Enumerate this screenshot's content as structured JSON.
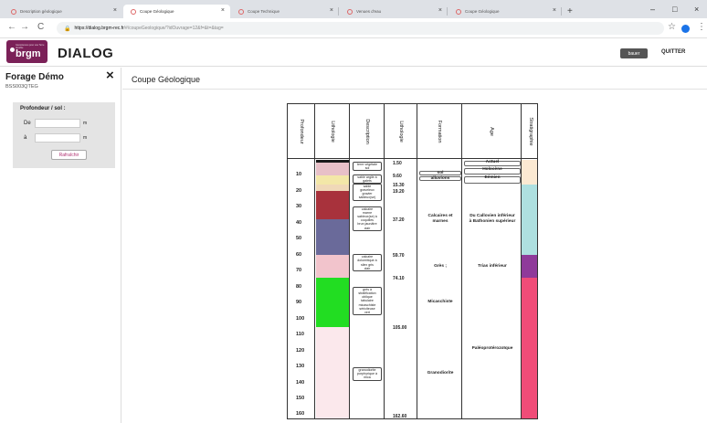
{
  "browser": {
    "tabs": [
      {
        "label": "Description géologique",
        "active": false
      },
      {
        "label": "Coupe Géologique",
        "active": true
      },
      {
        "label": "Coupe Technique",
        "active": false
      },
      {
        "label": "Venues d'eau",
        "active": false
      },
      {
        "label": "Coupe Géologique",
        "active": false
      }
    ],
    "new_tab": "+",
    "url_domain": "https://dialog.brgm-rec.fr",
    "url_path": "/#/coupeGeologique/?idOuvrage=12&f=&t=&tag=",
    "controls": {
      "minimize": "–",
      "maximize": "□",
      "close": "×"
    },
    "nav": {
      "back": "←",
      "forward": "→",
      "reload": "C"
    }
  },
  "app": {
    "logo": "brgm",
    "logo_tagline": "Géosciences pour une Terre durable",
    "title": "DIALOG",
    "user_button": "bauer",
    "quit_label": "QUITTER"
  },
  "sidebar": {
    "title": "Forage Démo",
    "code": "BSS003QTEG",
    "close_icon": "×",
    "filter": {
      "heading": "Profondeur / sol :",
      "from_label": "De",
      "to_label": "à",
      "unit": "m",
      "from_value": "",
      "to_value": "",
      "refresh_label": "Rafraîchir"
    }
  },
  "main": {
    "title": "Coupe Géologique",
    "headers": {
      "depth": "Profondeur",
      "lithology": "Lithologie",
      "description": "Description",
      "lithology_depth": "Lithologie",
      "formation": "Formation",
      "age": "Age",
      "stratigraphy": "Stratigraphie"
    }
  },
  "chart_data": {
    "type": "table",
    "depth_axis": {
      "min": 0,
      "max": 162.6,
      "ticks": [
        10,
        20,
        30,
        40,
        50,
        60,
        70,
        80,
        90,
        100,
        110,
        120,
        130,
        140,
        150,
        160
      ]
    },
    "layer_boundaries": [
      "1.50",
      "9.60",
      "15.30",
      "19.20",
      "37.20",
      "59.70",
      "74.10",
      "105.00",
      "162.60"
    ],
    "boundary_values": [
      1.5,
      9.6,
      15.3,
      19.2,
      37.2,
      59.7,
      74.1,
      105.0,
      162.6
    ],
    "lithology": [
      {
        "from": 0,
        "to": 1.5,
        "color": "#1a1a1a"
      },
      {
        "from": 1.5,
        "to": 9.6,
        "color": "#e8c0c8"
      },
      {
        "from": 9.6,
        "to": 15.3,
        "color": "#f3e7a8"
      },
      {
        "from": 15.3,
        "to": 19.2,
        "color": "#f0d8b8"
      },
      {
        "from": 19.2,
        "to": 37.2,
        "color": "#a8323c"
      },
      {
        "from": 37.2,
        "to": 59.7,
        "color": "#6a6a9a"
      },
      {
        "from": 59.7,
        "to": 74.1,
        "color": "#f2c4cc"
      },
      {
        "from": 74.1,
        "to": 105.0,
        "color": "#22dd22"
      },
      {
        "from": 105.0,
        "to": 162.6,
        "color": "#fbe8ec"
      }
    ],
    "descriptions": [
      {
        "at": 1.5,
        "text": "terre végétale\nsol"
      },
      {
        "at": 9.6,
        "text": "sable argile à\ngalets"
      },
      {
        "at": 15.3,
        "text": "sable\ngraveleux\ngravier\nsableux(se)"
      },
      {
        "at": 29.5,
        "text": "calcaire\nmarne\nsableux(se) à\ncoquilles\nbrun jaunâtre\nclair"
      },
      {
        "at": 59.7,
        "text": "calcaire\ndolomitique à\nsilex gris\nclair"
      },
      {
        "at": 80.0,
        "text": "grès à\nstratification\noblique\ntabulaire\nmicaschiste\nsériciteuse\nvert"
      },
      {
        "at": 130.5,
        "text": "granodiorite\nporphyrique à\nmica"
      }
    ],
    "formations": [
      {
        "from": 0,
        "to": 9.6,
        "label": "sol"
      },
      {
        "from": 9.6,
        "to": 15.3,
        "label": "alluvions"
      },
      {
        "from": 15.3,
        "to": 59.7,
        "label": "Calcaires et\nmarnes"
      },
      {
        "from": 59.7,
        "to": 74.1,
        "label": "Grès ;"
      },
      {
        "from": 74.1,
        "to": 105.0,
        "label": "Micaschiste"
      },
      {
        "from": 105.0,
        "to": 162.6,
        "label": "Granodiorite"
      }
    ],
    "ages": [
      {
        "from": 0,
        "to": 4.5,
        "label": "Actuel"
      },
      {
        "from": 4.5,
        "to": 9.6,
        "label": "Holocène"
      },
      {
        "from": 9.6,
        "to": 15.3,
        "label": "Eémien"
      },
      {
        "from": 15.3,
        "to": 59.7,
        "label": "Du Callovien inférieur\nà Bathonien supérieur"
      },
      {
        "from": 59.7,
        "to": 74.1,
        "label": "Trias inférieur"
      },
      {
        "from": 74.1,
        "to": 162.6,
        "label": "Paléoprotérozoïque"
      }
    ],
    "stratigraphy": [
      {
        "from": 0,
        "to": 15.3,
        "color": "#fbe9d2"
      },
      {
        "from": 15.3,
        "to": 59.7,
        "color": "#aee0e0"
      },
      {
        "from": 59.7,
        "to": 74.1,
        "color": "#8f3a9a"
      },
      {
        "from": 74.1,
        "to": 162.6,
        "color": "#f04c78"
      }
    ]
  }
}
